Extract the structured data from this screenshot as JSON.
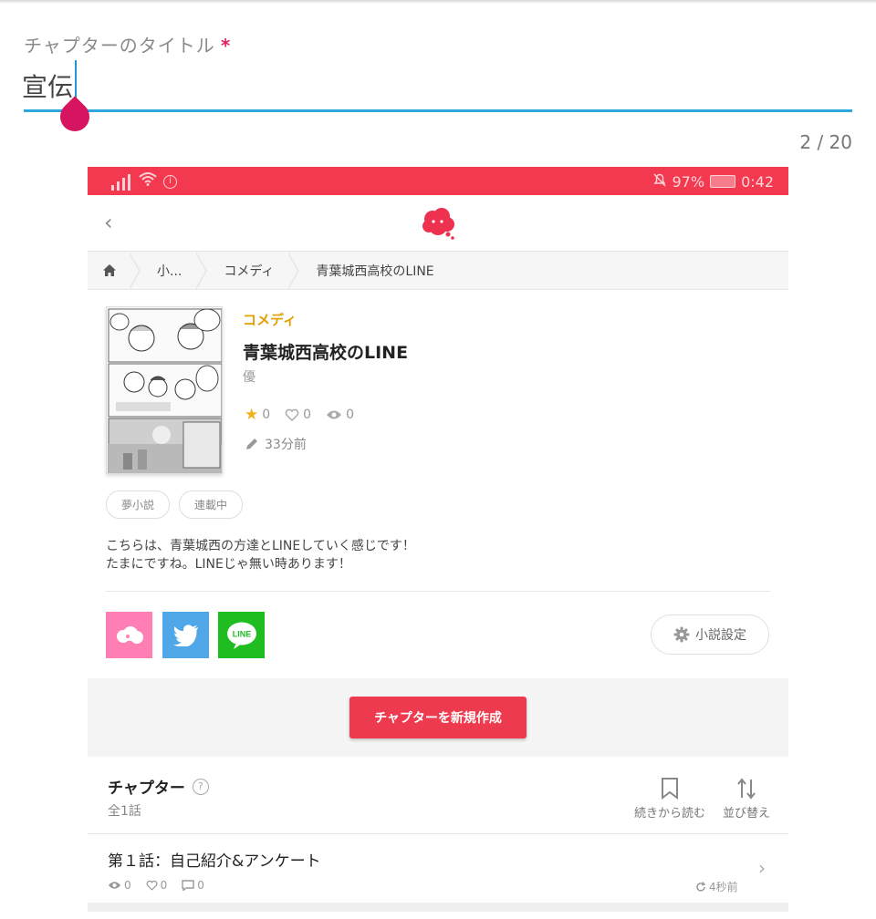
{
  "title_field": {
    "label": "チャプターのタイトル",
    "required_mark": "*",
    "value": "宣伝",
    "counter": "2 / 20"
  },
  "status_bar": {
    "battery": "97%",
    "time": "0:42"
  },
  "breadcrumb": {
    "items": [
      "小...",
      "コメディ",
      "青葉城西高校のLINE"
    ]
  },
  "novel": {
    "genre": "コメディ",
    "title": "青葉城西高校のLINE",
    "author": "優",
    "stars": "0",
    "likes": "0",
    "views": "0",
    "updated": "33分前",
    "tags": [
      "夢小説",
      "連載中"
    ],
    "description_lines": [
      "こちらは、青葉城西の方達とLINEしていく感じです！",
      "たまにですね。LINEじゃ無い時あります！"
    ]
  },
  "share": {
    "line_label": "LINE"
  },
  "settings_button": "小説設定",
  "create_button": "チャプターを新規作成",
  "chapters": {
    "heading": "チャプター",
    "help": "?",
    "count": "全1話",
    "resume_label": "続きから読む",
    "sort_label": "並び替え",
    "items": [
      {
        "title": "第１話：自己紹介&アンケート",
        "views": "0",
        "likes": "0",
        "comments": "0",
        "time": "4秒前"
      }
    ]
  },
  "colors": {
    "accent": "#2ea8dc",
    "caret_handle": "#d6145f",
    "status_bar": "#f2394f",
    "primary_button": "#ee3a4f",
    "genre": "#e2a000",
    "share_pink": "#ff7eb3",
    "share_twitter": "#4fa7e8",
    "share_line": "#1fbd1f"
  }
}
